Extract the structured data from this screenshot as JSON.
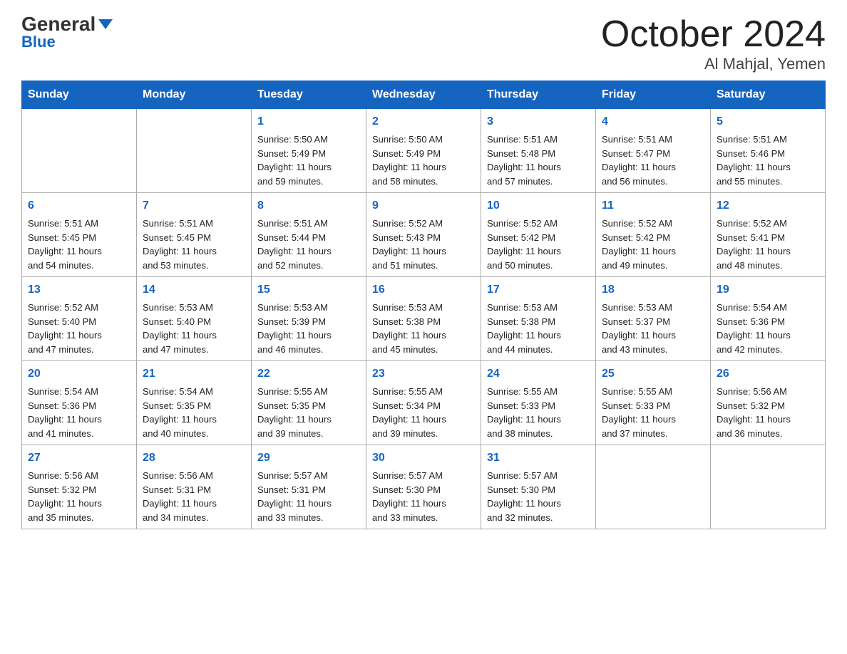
{
  "logo": {
    "general": "General",
    "blue": "Blue"
  },
  "header": {
    "month": "October 2024",
    "location": "Al Mahjal, Yemen"
  },
  "weekdays": [
    "Sunday",
    "Monday",
    "Tuesday",
    "Wednesday",
    "Thursday",
    "Friday",
    "Saturday"
  ],
  "weeks": [
    [
      {
        "day": "",
        "data": ""
      },
      {
        "day": "",
        "data": ""
      },
      {
        "day": "1",
        "data": "Sunrise: 5:50 AM\nSunset: 5:49 PM\nDaylight: 11 hours\nand 59 minutes."
      },
      {
        "day": "2",
        "data": "Sunrise: 5:50 AM\nSunset: 5:49 PM\nDaylight: 11 hours\nand 58 minutes."
      },
      {
        "day": "3",
        "data": "Sunrise: 5:51 AM\nSunset: 5:48 PM\nDaylight: 11 hours\nand 57 minutes."
      },
      {
        "day": "4",
        "data": "Sunrise: 5:51 AM\nSunset: 5:47 PM\nDaylight: 11 hours\nand 56 minutes."
      },
      {
        "day": "5",
        "data": "Sunrise: 5:51 AM\nSunset: 5:46 PM\nDaylight: 11 hours\nand 55 minutes."
      }
    ],
    [
      {
        "day": "6",
        "data": "Sunrise: 5:51 AM\nSunset: 5:45 PM\nDaylight: 11 hours\nand 54 minutes."
      },
      {
        "day": "7",
        "data": "Sunrise: 5:51 AM\nSunset: 5:45 PM\nDaylight: 11 hours\nand 53 minutes."
      },
      {
        "day": "8",
        "data": "Sunrise: 5:51 AM\nSunset: 5:44 PM\nDaylight: 11 hours\nand 52 minutes."
      },
      {
        "day": "9",
        "data": "Sunrise: 5:52 AM\nSunset: 5:43 PM\nDaylight: 11 hours\nand 51 minutes."
      },
      {
        "day": "10",
        "data": "Sunrise: 5:52 AM\nSunset: 5:42 PM\nDaylight: 11 hours\nand 50 minutes."
      },
      {
        "day": "11",
        "data": "Sunrise: 5:52 AM\nSunset: 5:42 PM\nDaylight: 11 hours\nand 49 minutes."
      },
      {
        "day": "12",
        "data": "Sunrise: 5:52 AM\nSunset: 5:41 PM\nDaylight: 11 hours\nand 48 minutes."
      }
    ],
    [
      {
        "day": "13",
        "data": "Sunrise: 5:52 AM\nSunset: 5:40 PM\nDaylight: 11 hours\nand 47 minutes."
      },
      {
        "day": "14",
        "data": "Sunrise: 5:53 AM\nSunset: 5:40 PM\nDaylight: 11 hours\nand 47 minutes."
      },
      {
        "day": "15",
        "data": "Sunrise: 5:53 AM\nSunset: 5:39 PM\nDaylight: 11 hours\nand 46 minutes."
      },
      {
        "day": "16",
        "data": "Sunrise: 5:53 AM\nSunset: 5:38 PM\nDaylight: 11 hours\nand 45 minutes."
      },
      {
        "day": "17",
        "data": "Sunrise: 5:53 AM\nSunset: 5:38 PM\nDaylight: 11 hours\nand 44 minutes."
      },
      {
        "day": "18",
        "data": "Sunrise: 5:53 AM\nSunset: 5:37 PM\nDaylight: 11 hours\nand 43 minutes."
      },
      {
        "day": "19",
        "data": "Sunrise: 5:54 AM\nSunset: 5:36 PM\nDaylight: 11 hours\nand 42 minutes."
      }
    ],
    [
      {
        "day": "20",
        "data": "Sunrise: 5:54 AM\nSunset: 5:36 PM\nDaylight: 11 hours\nand 41 minutes."
      },
      {
        "day": "21",
        "data": "Sunrise: 5:54 AM\nSunset: 5:35 PM\nDaylight: 11 hours\nand 40 minutes."
      },
      {
        "day": "22",
        "data": "Sunrise: 5:55 AM\nSunset: 5:35 PM\nDaylight: 11 hours\nand 39 minutes."
      },
      {
        "day": "23",
        "data": "Sunrise: 5:55 AM\nSunset: 5:34 PM\nDaylight: 11 hours\nand 39 minutes."
      },
      {
        "day": "24",
        "data": "Sunrise: 5:55 AM\nSunset: 5:33 PM\nDaylight: 11 hours\nand 38 minutes."
      },
      {
        "day": "25",
        "data": "Sunrise: 5:55 AM\nSunset: 5:33 PM\nDaylight: 11 hours\nand 37 minutes."
      },
      {
        "day": "26",
        "data": "Sunrise: 5:56 AM\nSunset: 5:32 PM\nDaylight: 11 hours\nand 36 minutes."
      }
    ],
    [
      {
        "day": "27",
        "data": "Sunrise: 5:56 AM\nSunset: 5:32 PM\nDaylight: 11 hours\nand 35 minutes."
      },
      {
        "day": "28",
        "data": "Sunrise: 5:56 AM\nSunset: 5:31 PM\nDaylight: 11 hours\nand 34 minutes."
      },
      {
        "day": "29",
        "data": "Sunrise: 5:57 AM\nSunset: 5:31 PM\nDaylight: 11 hours\nand 33 minutes."
      },
      {
        "day": "30",
        "data": "Sunrise: 5:57 AM\nSunset: 5:30 PM\nDaylight: 11 hours\nand 33 minutes."
      },
      {
        "day": "31",
        "data": "Sunrise: 5:57 AM\nSunset: 5:30 PM\nDaylight: 11 hours\nand 32 minutes."
      },
      {
        "day": "",
        "data": ""
      },
      {
        "day": "",
        "data": ""
      }
    ]
  ]
}
